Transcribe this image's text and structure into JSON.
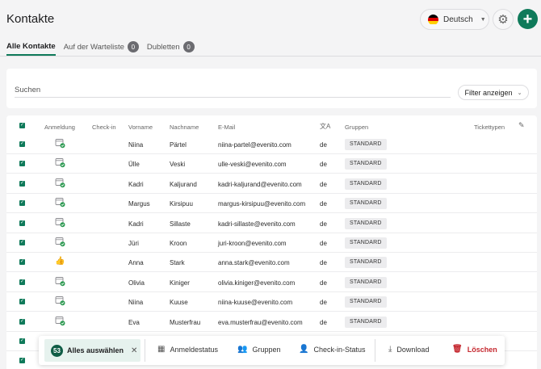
{
  "header": {
    "title": "Kontakte",
    "language": "Deutsch"
  },
  "tabs": [
    {
      "label": "Alle Kontakte",
      "active": true
    },
    {
      "label": "Auf der Warteliste",
      "count": "0"
    },
    {
      "label": "Dubletten",
      "count": "0"
    }
  ],
  "search": {
    "placeholder": "Suchen",
    "filter_label": "Filter anzeigen"
  },
  "table": {
    "columns": [
      "Anmeldung",
      "Check-in",
      "Vorname",
      "Nachname",
      "E-Mail",
      "Gruppen",
      "Tickettypen"
    ],
    "rows": [
      {
        "first": "Niina",
        "last": "Pärtel",
        "email": "niina-partel@evenito.com",
        "lang": "de",
        "group": "STANDARD",
        "reg": "calendar-check"
      },
      {
        "first": "Ülle",
        "last": "Veski",
        "email": "ulle-veski@evenito.com",
        "lang": "de",
        "group": "STANDARD",
        "reg": "calendar-check"
      },
      {
        "first": "Kadri",
        "last": "Kaljurand",
        "email": "kadri-kaljurand@evenito.com",
        "lang": "de",
        "group": "STANDARD",
        "reg": "calendar-check"
      },
      {
        "first": "Margus",
        "last": "Kirsipuu",
        "email": "margus-kirsipuu@evenito.com",
        "lang": "de",
        "group": "STANDARD",
        "reg": "calendar-check"
      },
      {
        "first": "Kadri",
        "last": "Sillaste",
        "email": "kadri-sillaste@evenito.com",
        "lang": "de",
        "group": "STANDARD",
        "reg": "calendar-check"
      },
      {
        "first": "Jüri",
        "last": "Kroon",
        "email": "juri-kroon@evenito.com",
        "lang": "de",
        "group": "STANDARD",
        "reg": "calendar-check"
      },
      {
        "first": "Anna",
        "last": "Stark",
        "email": "anna.stark@evenito.com",
        "lang": "de",
        "group": "STANDARD",
        "reg": "thumbs-up"
      },
      {
        "first": "Olivia",
        "last": "Kiniger",
        "email": "olivia.kiniger@evenito.com",
        "lang": "de",
        "group": "STANDARD",
        "reg": "calendar-check"
      },
      {
        "first": "Niina",
        "last": "Kuuse",
        "email": "niina-kuuse@evenito.com",
        "lang": "de",
        "group": "STANDARD",
        "reg": "calendar-check"
      },
      {
        "first": "Eva",
        "last": "Musterfrau",
        "email": "eva.musterfrau@evenito.com",
        "lang": "de",
        "group": "STANDARD",
        "reg": "calendar-check"
      }
    ]
  },
  "actionbar": {
    "selected_count": "53",
    "select_all_label": "Alles auswählen",
    "actions": [
      "Anmeldestatus",
      "Gruppen",
      "Check-in-Status",
      "Download",
      "Löschen"
    ]
  },
  "colors": {
    "accent": "#0f7a5a",
    "danger": "#c5282f",
    "success": "#2f9b53"
  }
}
